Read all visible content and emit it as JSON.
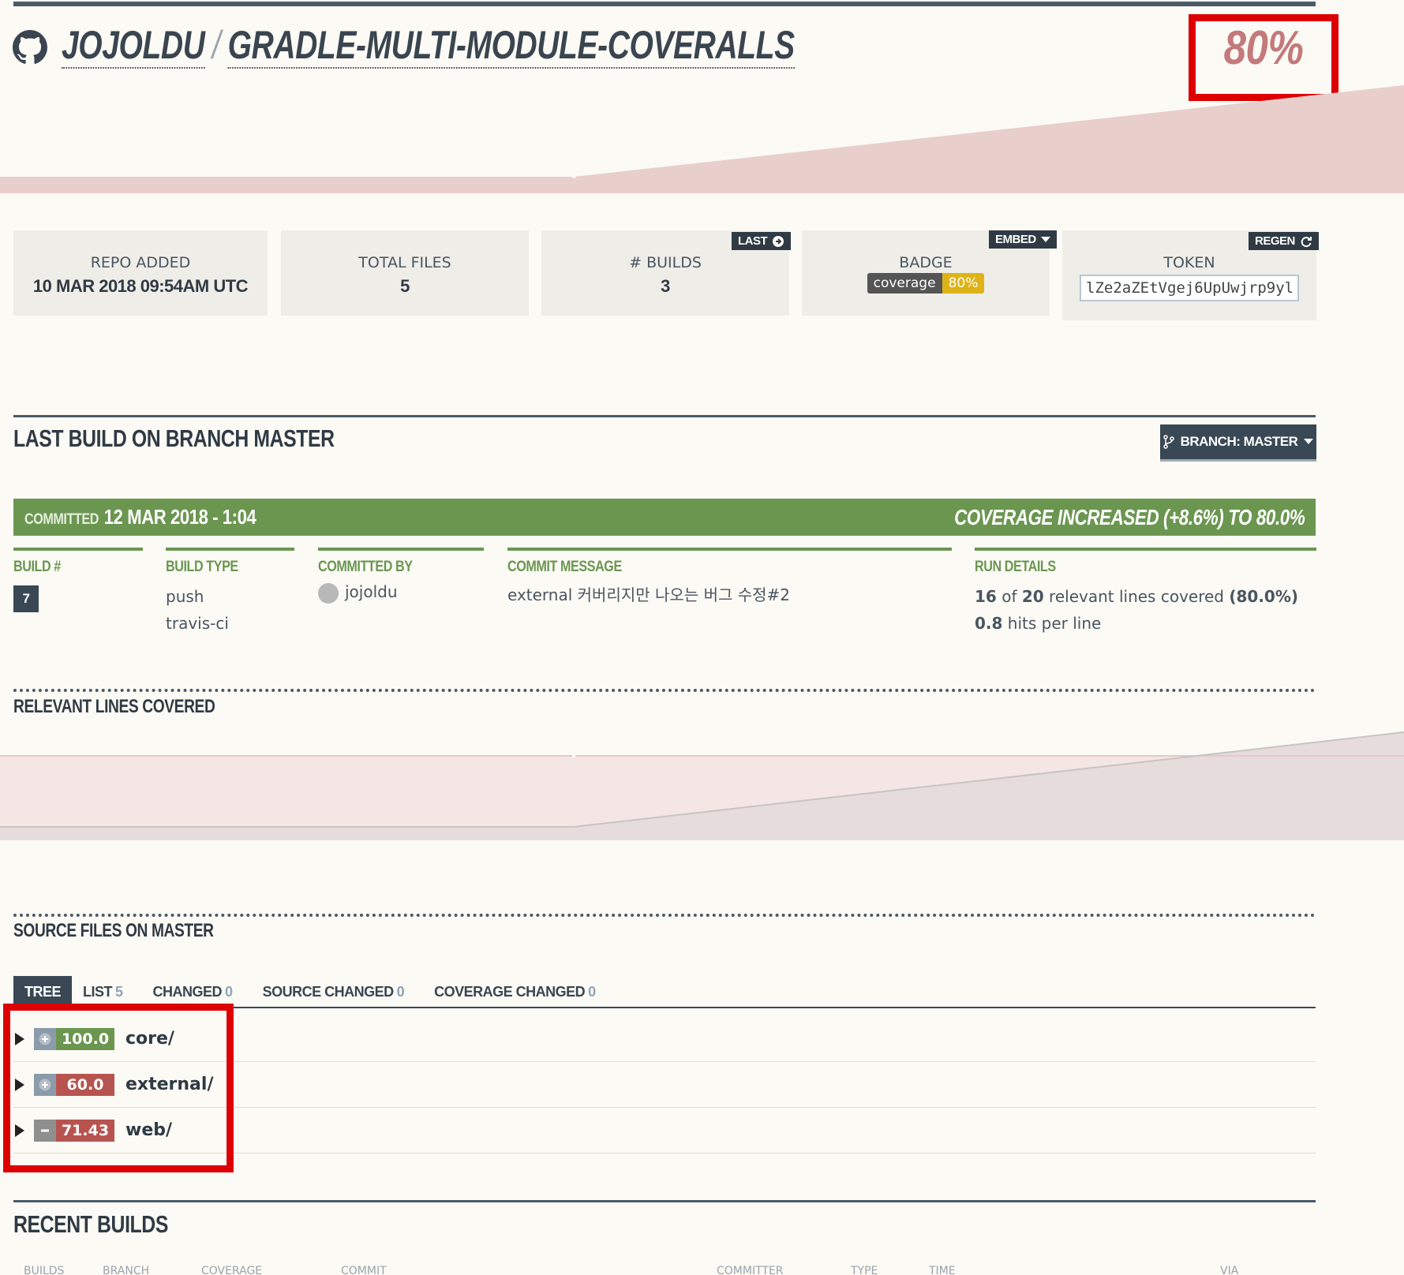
{
  "header": {
    "owner": "JOJOLDU",
    "repo": "GRADLE-MULTI-MODULE-COVERALLS",
    "coverage_percent": "80%",
    "accent_color": "#c4797a"
  },
  "stats": {
    "repo_added": {
      "label": "REPO ADDED",
      "value": "10 MAR 2018 09:54AM UTC"
    },
    "total_files": {
      "label": "TOTAL FILES",
      "value": "5"
    },
    "builds": {
      "label": "# BUILDS",
      "value": "3",
      "action": "LAST"
    },
    "badge": {
      "label": "BADGE",
      "action": "EMBED",
      "left": "coverage",
      "right": "80%"
    },
    "token": {
      "label": "TOKEN",
      "action": "REGEN",
      "value": "lZe2aZEtVgej6UpUwjrp9yl"
    }
  },
  "last_build": {
    "heading": "LAST BUILD ON BRANCH MASTER",
    "branch_button": "BRANCH: MASTER",
    "committed_label": "COMMITTED",
    "committed_date": "12 MAR 2018 - 1:04",
    "coverage_change": "COVERAGE INCREASED (+8.6%) TO 80.0%",
    "status_color": "#6b9650",
    "columns": {
      "build": {
        "header": "BUILD #",
        "value": "7"
      },
      "build_type": {
        "header": "BUILD TYPE",
        "values": [
          "push",
          "travis-ci"
        ]
      },
      "committed_by": {
        "header": "COMMITTED BY",
        "value": "jojoldu"
      },
      "commit_message": {
        "header": "COMMIT MESSAGE",
        "value": "external 커버리지만 나오는 버그 수정#2"
      },
      "run_details": {
        "header": "RUN DETAILS",
        "covered": "16",
        "of": "of",
        "relevant": "20",
        "relevant_text": "relevant lines covered",
        "percent": "(80.0%)",
        "hits": "0.8",
        "hits_text": "hits per line"
      }
    }
  },
  "relevant_lines": {
    "heading": "RELEVANT LINES COVERED"
  },
  "source_files": {
    "heading": "SOURCE FILES ON MASTER",
    "tabs": [
      {
        "label": "TREE",
        "count": ""
      },
      {
        "label": "LIST",
        "count": "5"
      },
      {
        "label": "CHANGED",
        "count": "0"
      },
      {
        "label": "SOURCE CHANGED",
        "count": "0"
      },
      {
        "label": "COVERAGE CHANGED",
        "count": "0"
      }
    ],
    "tree": [
      {
        "icon": "plus-icon",
        "coverage": "100.0",
        "name": "core/",
        "color": "#6b9650"
      },
      {
        "icon": "plus-icon",
        "coverage": "60.0",
        "name": "external/",
        "color": "#b85450"
      },
      {
        "icon": "minus-icon",
        "coverage": "71.43",
        "name": "web/",
        "color": "#b85450"
      }
    ]
  },
  "recent_builds": {
    "heading": "RECENT BUILDS",
    "columns": [
      "BUILDS",
      "BRANCH",
      "COVERAGE",
      "COMMIT",
      "COMMITTER",
      "TYPE",
      "TIME",
      "VIA"
    ]
  }
}
